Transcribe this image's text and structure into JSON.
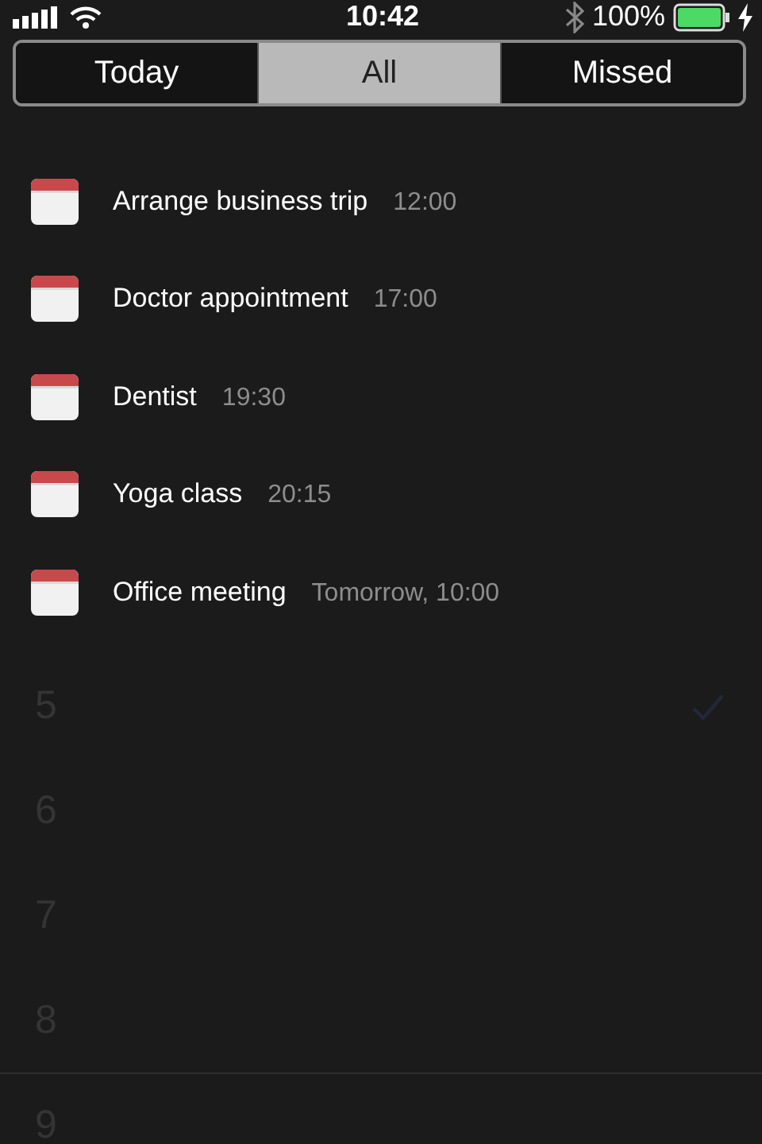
{
  "status_bar": {
    "time": "10:42",
    "battery": "100%",
    "charging": true
  },
  "segments": [
    {
      "label": "Today",
      "selected": false
    },
    {
      "label": "All",
      "selected": true
    },
    {
      "label": "Missed",
      "selected": false
    }
  ],
  "events": [
    {
      "title": "Arrange business trip",
      "time": "12:00"
    },
    {
      "title": "Doctor appointment",
      "time": "17:00"
    },
    {
      "title": "Dentist",
      "time": "19:30"
    },
    {
      "title": "Yoga class",
      "time": "20:15"
    },
    {
      "title": "Office meeting",
      "time": "Tomorrow, 10:00"
    }
  ],
  "background_options": [
    {
      "label": "5",
      "checked": true
    },
    {
      "label": "6",
      "checked": false
    },
    {
      "label": "7",
      "checked": false
    },
    {
      "label": "8",
      "checked": false
    },
    {
      "label": "9",
      "checked": false
    }
  ]
}
